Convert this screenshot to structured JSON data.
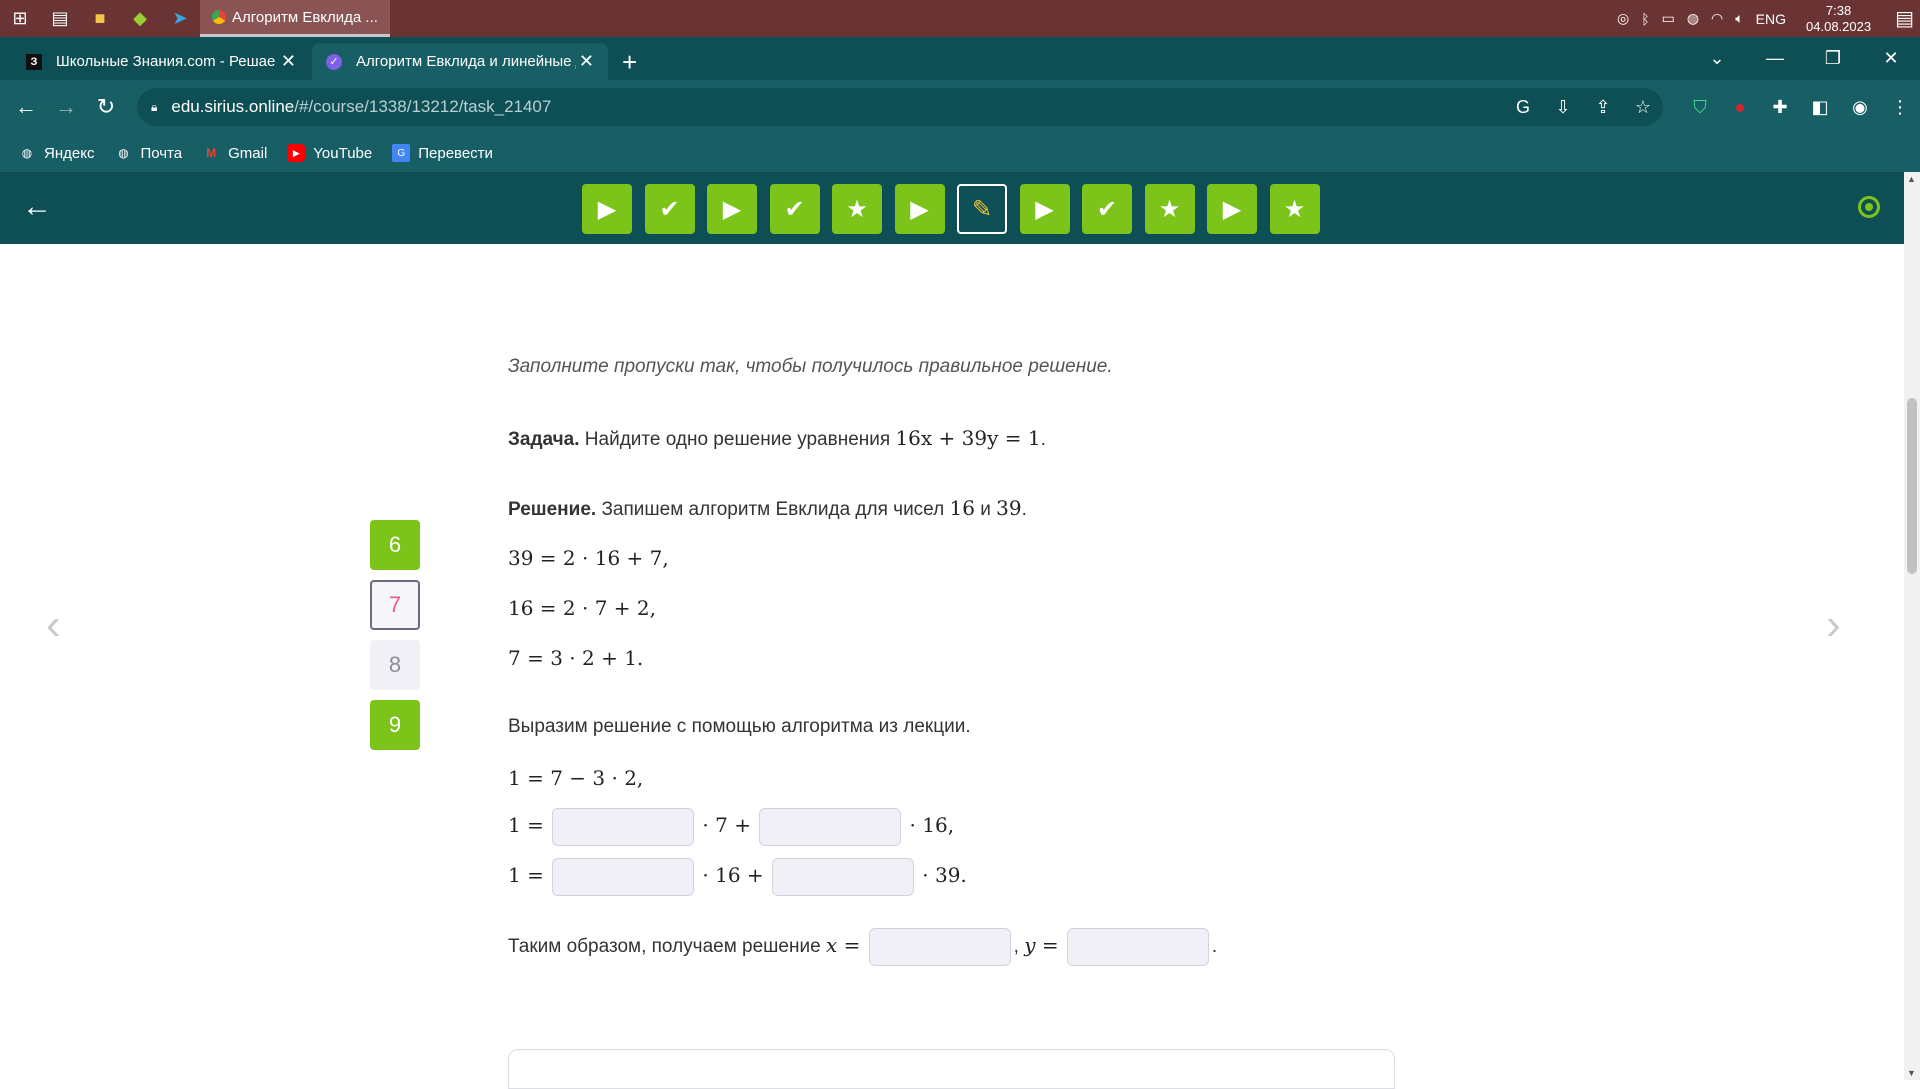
{
  "taskbar": {
    "active_window": "Алгоритм Евклида ...",
    "lang": "ENG",
    "time": "7:38",
    "date": "04.08.2023"
  },
  "tabs": [
    {
      "title": "Школьные Знания.com - Решае",
      "favicon": "З"
    },
    {
      "title": "Алгоритм Евклида и линейные д",
      "favicon": "✓"
    }
  ],
  "address": {
    "host": "edu.sirius.online",
    "path": "/#/course/1338/13212/task_21407"
  },
  "bookmarks": [
    "Яндекс",
    "Почта",
    "Gmail",
    "YouTube",
    "Перевести"
  ],
  "task_bar": {
    "items": [
      "play-icon",
      "check-icon",
      "play-icon",
      "check-icon",
      "star-icon",
      "play-icon",
      "pencil-icon",
      "play-icon",
      "check-icon",
      "star-icon",
      "play-icon",
      "star-icon"
    ],
    "current_index": 6
  },
  "subtasks": [
    {
      "label": "6",
      "state": "done"
    },
    {
      "label": "7",
      "state": "current"
    },
    {
      "label": "8",
      "state": "todo"
    },
    {
      "label": "9",
      "state": "done"
    }
  ],
  "problem": {
    "hint": "Заполните пропуски так, чтобы получилось правильное решение.",
    "task_label": "Задача.",
    "task_text": "Найдите одно решение уравнения",
    "equation": "16x + 39y = 1",
    "solution_label": "Решение.",
    "solution_text_a": "Запишем алгоритм Евклида для чисел",
    "num_a": "16",
    "and_word": "и",
    "num_b": "39",
    "steps": [
      "39 = 2 · 16 + 7,",
      "16 = 2 · 7 + 2,",
      "7 = 3 · 2 + 1."
    ],
    "express_text": "Выразим решение с помощью алгоритма из лекции.",
    "express_line": "1 = 7 − 3 · 2,",
    "row1": {
      "start": "1 =",
      "mid": "· 7 +",
      "end": "· 16,"
    },
    "row2": {
      "start": "1 =",
      "mid": "· 16 +",
      "end": "· 39."
    },
    "conclusion_text": "Таким образом, получаем решение",
    "x_eq": "x =",
    "y_eq": "y ="
  }
}
